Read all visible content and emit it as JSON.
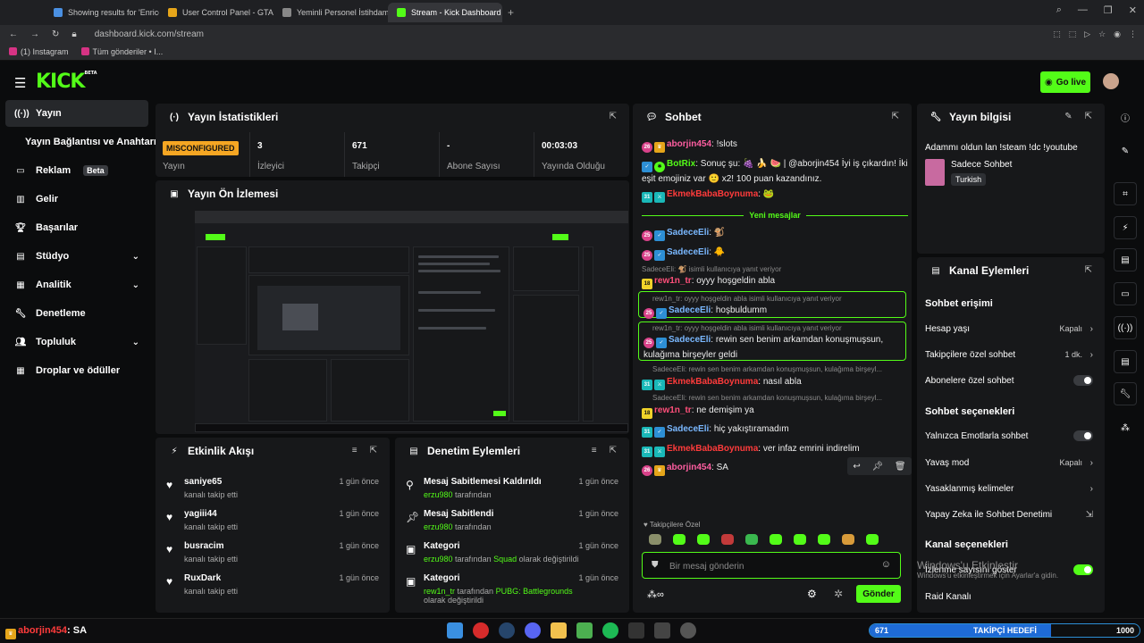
{
  "browser": {
    "tabs": [
      {
        "label": "Showing results for 'Enrico",
        "color": "#4a90e2"
      },
      {
        "label": "User Control Panel - GTA V",
        "color": "#e5a51a"
      },
      {
        "label": "Yeminli Personel İstihdamı",
        "color": "#888888"
      },
      {
        "label": "Stream - Kick Dashboard",
        "color": "#53fc18"
      }
    ],
    "new_tab": "+",
    "url": "dashboard.kick.com/stream",
    "bookmarks": [
      "(1) Instagram",
      "Tüm gönderiler • I..."
    ]
  },
  "header": {
    "logo": "KICK",
    "logo_sup": "BETA",
    "go_live": "Go live"
  },
  "sidebar": {
    "items": [
      {
        "label": "Yayın",
        "icon": "broadcast-icon"
      },
      {
        "label": "Yayın Bağlantısı ve Anahtarı"
      },
      {
        "label": "Reklam",
        "badge": "Beta",
        "icon": "ads-icon"
      },
      {
        "label": "Gelir",
        "icon": "revenue-icon"
      },
      {
        "label": "Başarılar",
        "icon": "trophy-icon"
      },
      {
        "label": "Stüdyo",
        "icon": "studio-icon"
      },
      {
        "label": "Analitik",
        "icon": "analytics-icon"
      },
      {
        "label": "Denetleme",
        "icon": "moderation-icon"
      },
      {
        "label": "Topluluk",
        "icon": "community-icon"
      },
      {
        "label": "Droplar ve ödüller",
        "icon": "drops-icon"
      }
    ]
  },
  "stats": {
    "title": "Yayın İstatistikleri",
    "cells": [
      {
        "value": "MISCONFIGURED",
        "label": "Yayın"
      },
      {
        "value": "3",
        "label": "İzleyici"
      },
      {
        "value": "671",
        "label": "Takipçi"
      },
      {
        "value": "-",
        "label": "Abone Sayısı"
      },
      {
        "value": "00:03:03",
        "label": "Yayında Olduğu"
      }
    ]
  },
  "preview": {
    "title": "Yayın Ön İzlemesi"
  },
  "activity": {
    "title": "Etkinlik Akışı",
    "rows": [
      {
        "name": "saniye65",
        "sub": "kanalı takip etti",
        "time": "1 gün önce"
      },
      {
        "name": "yagiii44",
        "sub": "kanalı takip etti",
        "time": "1 gün önce"
      },
      {
        "name": "busracim",
        "sub": "kanalı takip etti",
        "time": "1 gün önce"
      },
      {
        "name": "RuxDark",
        "sub": "kanalı takip etti",
        "time": "1 gün önce"
      }
    ]
  },
  "modlog": {
    "title": "Denetim Eylemleri",
    "rows": [
      {
        "title": "Mesaj Sabitlemesi Kaldırıldı",
        "user": "erzu980",
        "sub": "tarafından",
        "time": "1 gün önce"
      },
      {
        "title": "Mesaj Sabitlendi",
        "user": "erzu980",
        "sub": "tarafından",
        "time": "1 gün önce"
      },
      {
        "title": "Kategori",
        "user": "erzu980",
        "sub": "tarafından",
        "cat": "Squad",
        "sub2": "olarak değiştirildi",
        "time": "1 gün önce"
      },
      {
        "title": "Kategori",
        "user": "rew1n_tr",
        "sub": "tarafından",
        "cat": "PUBG: Battlegrounds",
        "sub2": "olarak değiştirildi",
        "time": "1 gün önce"
      }
    ]
  },
  "chat": {
    "title": "Sohbet",
    "new_messages": "Yeni mesajlar",
    "m1_user": "aborjin454",
    "m1_text": ": !slots",
    "m2_user": "BotRix",
    "m2_text": ": Sonuç şu: 🍇 🍌 🍉 | @aborjin454 İyi iş çıkardın! İki eşit emojiniz var 🙂 x2! 100 puan kazandınız.",
    "m3_user": "EkmekBabaBoynuma",
    "m3_text": ":",
    "m4_user": "SadeceEli",
    "m4_text": ":",
    "m5_user": "SadeceEli",
    "m5_text": ":",
    "r1": "SadeceEli: 🐒 isimli kullanıcıya yanıt veriyor",
    "m6_user": "rew1n_tr",
    "m6_text": ": oyyy hoşgeldin abla",
    "r2": "rew1n_tr: oyyy hoşgeldin abla isimli kullanıcıya yanıt veriyor",
    "m7_user": "SadeceEli",
    "m7_text": ": hoşbuldumm",
    "r3": "rew1n_tr: oyyy hoşgeldin abla isimli kullanıcıya yanıt veriyor",
    "m8_user": "SadeceEli",
    "m8_text": ": rewin sen benim arkamdan konuşmuşsun, kulağıma birşeyler geldi",
    "r4": "SadeceEli: rewin sen benim arkamdan konuşmuşsun, kulağıma birşeyl...",
    "m9_user": "EkmekBabaBoynuma",
    "m9_text": ": nasıl abla",
    "r5": "SadeceEli: rewin sen benim arkamdan konuşmuşsun, kulağıma birşeyl...",
    "m10_user": "rew1n_tr",
    "m10_text": ": ne demişim ya",
    "m11_user": "SadeceEli",
    "m11_text": ": hiç yakıştıramadım",
    "m12_user": "EkmekBabaBoynuma",
    "m12_text": ": ver infaz emrini indirelim",
    "m13_user": "aborjin454",
    "m13_text": ": SA",
    "followers_only": "♥ Takipçilere Özel",
    "input_placeholder": "Bir mesaj gönderin",
    "send": "Gönder"
  },
  "stream_info": {
    "title": "Yayın bilgisi",
    "stream_title": "Adammı oldun lan !steam !dc !youtube",
    "category": "Sadece Sohbet",
    "language": "Turkish"
  },
  "channel_actions": {
    "title": "Kanal Eylemleri",
    "sec1": "Sohbet erişimi",
    "r_age": "Hesap yaşı",
    "r_age_v": "Kapalı",
    "r_follow": "Takipçilere özel sohbet",
    "r_follow_v": "1 dk.",
    "r_subs": "Abonelere özel sohbet",
    "sec2": "Sohbet seçenekleri",
    "r_emote": "Yalnızca Emotlarla sohbet",
    "r_slow": "Yavaş mod",
    "r_slow_v": "Kapalı",
    "r_banned": "Yasaklanmış kelimeler",
    "r_ai": "Yapay Zeka ile Sohbet Denetimi",
    "sec3": "Kanal seçenekleri",
    "r_viewers": "İzlenme sayısını göster",
    "r_raid": "Raid Kanalı"
  },
  "watermark": {
    "line1": "Windows'u Etkinleştir",
    "line2": "Windows'u etkinleştirmek için Ayarlar'a gidin."
  },
  "taskbar": {
    "chat_user": "aborjin454",
    "chat_text": ": SA",
    "goal_current": "671",
    "goal_label": "TAKİPÇİ HEDEFİ",
    "goal_target": "1000",
    "goal_progress": 0.671
  },
  "colors": {
    "accent": "#53fc18",
    "panel": "#17181a",
    "bg": "#0b0c0d",
    "warn": "#f5a623"
  }
}
